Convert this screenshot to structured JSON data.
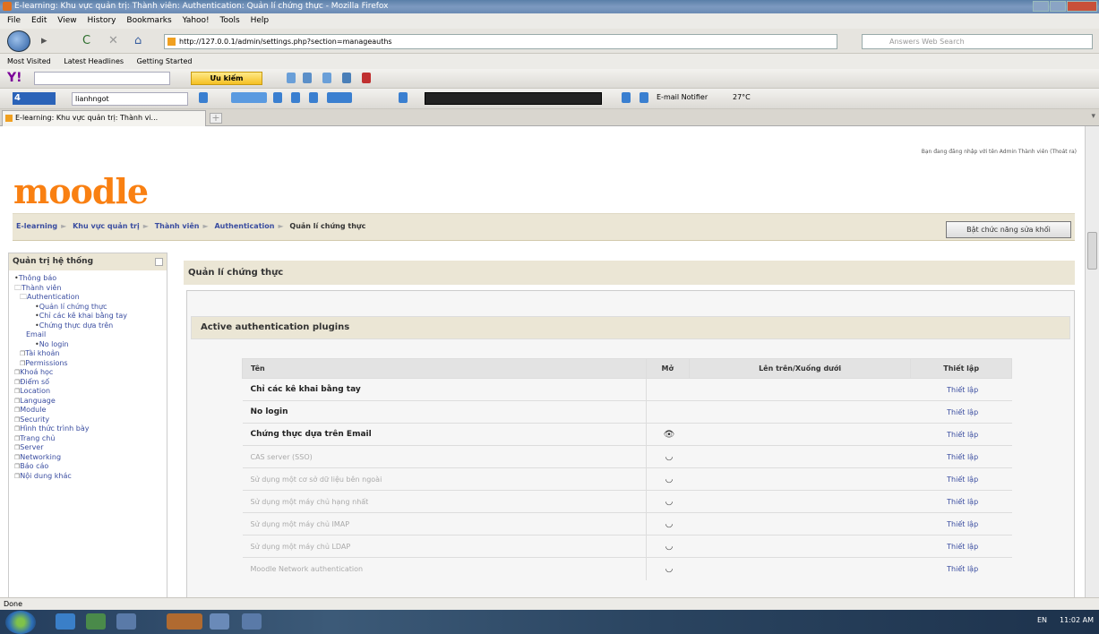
{
  "window": {
    "title": "E-learning: Khu vực quản trị: Thành viên: Authentication: Quản lí chứng thực - Mozilla Firefox"
  },
  "menu": [
    "File",
    "Edit",
    "View",
    "History",
    "Bookmarks",
    "Yahoo!",
    "Tools",
    "Help"
  ],
  "nav": {
    "url": "http://127.0.0.1/admin/settings.php?section=manageauths",
    "search_placeholder": "Answers Web Search"
  },
  "bookmarks": [
    "Most Visited",
    "Latest Headlines",
    "Getting Started"
  ],
  "yahoo": {
    "logo": "Y!",
    "button": "Ưu kiếm"
  },
  "toolbar4": {
    "logo": "4",
    "select": "lianhngot",
    "email": "E-mail Notifier",
    "temp": "27°C"
  },
  "tab": {
    "title": "E-learning: Khu vực quản trị: Thành vi..."
  },
  "page": {
    "logo": "moodle",
    "logged_in": "Bạn đang đăng nhập với tên Admin Thành viên (Thoát ra)",
    "breadcrumb": [
      "E-learning",
      "Khu vực quản trị",
      "Thành viên",
      "Authentication",
      "Quản lí chứng thực"
    ],
    "edit_button": "Bật chức năng sửa khối",
    "sidebar": {
      "title": "Quản trị hệ thống",
      "items": [
        {
          "label": "Thông báo",
          "kind": "bullet",
          "level": 1
        },
        {
          "label": "Thành viên",
          "kind": "folder-open",
          "level": 1
        },
        {
          "label": "Authentication",
          "kind": "folder-open",
          "level": 2
        },
        {
          "label": "Quản lí chứng thực",
          "kind": "bullet",
          "level": 4
        },
        {
          "label": "Chỉ các kê khai bằng tay",
          "kind": "bullet",
          "level": 4
        },
        {
          "label": "Chứng thực dựa trên",
          "kind": "bullet",
          "level": 4
        },
        {
          "label": "Email",
          "kind": "plain",
          "level": 3
        },
        {
          "label": "No login",
          "kind": "bullet",
          "level": 4
        },
        {
          "label": "Tài khoản",
          "kind": "folder",
          "level": 2
        },
        {
          "label": "Permissions",
          "kind": "folder",
          "level": 2
        },
        {
          "label": "Khoá học",
          "kind": "folder",
          "level": 1
        },
        {
          "label": "Điểm số",
          "kind": "folder",
          "level": 1
        },
        {
          "label": "Location",
          "kind": "folder",
          "level": 1
        },
        {
          "label": "Language",
          "kind": "folder",
          "level": 1
        },
        {
          "label": "Module",
          "kind": "folder",
          "level": 1
        },
        {
          "label": "Security",
          "kind": "folder",
          "level": 1
        },
        {
          "label": "Hình thức trình bày",
          "kind": "folder",
          "level": 1
        },
        {
          "label": "Trang chủ",
          "kind": "folder",
          "level": 1
        },
        {
          "label": "Server",
          "kind": "folder",
          "level": 1
        },
        {
          "label": "Networking",
          "kind": "folder",
          "level": 1
        },
        {
          "label": "Báo cáo",
          "kind": "folder",
          "level": 1
        },
        {
          "label": "Nội dung khác",
          "kind": "folder",
          "level": 1
        }
      ]
    },
    "main_title": "Quản lí chứng thực",
    "section_title": "Active authentication plugins",
    "table": {
      "headers": [
        "Tên",
        "Mở",
        "Lên trên/Xuống dưới",
        "Thiết lập"
      ],
      "rows": [
        {
          "name": "Chỉ các kê khai bằng tay",
          "enabled": "",
          "setting": "Thiết lập",
          "dim": false
        },
        {
          "name": "No login",
          "enabled": "",
          "setting": "Thiết lập",
          "dim": false
        },
        {
          "name": "Chứng thực dựa trên Email",
          "enabled": "👁",
          "setting": "Thiết lập",
          "dim": false
        },
        {
          "name": "CAS server (SSO)",
          "enabled": "◡",
          "setting": "Thiết lập",
          "dim": true
        },
        {
          "name": "Sử dụng một cơ sở dữ liệu bên ngoài",
          "enabled": "◡",
          "setting": "Thiết lập",
          "dim": true
        },
        {
          "name": "Sử dụng một máy chủ hạng nhất",
          "enabled": "◡",
          "setting": "Thiết lập",
          "dim": true
        },
        {
          "name": "Sử dụng một máy chủ IMAP",
          "enabled": "◡",
          "setting": "Thiết lập",
          "dim": true
        },
        {
          "name": "Sử dụng một máy chủ LDAP",
          "enabled": "◡",
          "setting": "Thiết lập",
          "dim": true
        },
        {
          "name": "Moodle Network authentication",
          "enabled": "◡",
          "setting": "Thiết lập",
          "dim": true
        }
      ]
    }
  },
  "status": "Done",
  "tray": {
    "lang": "EN",
    "time": "11:02 AM"
  }
}
